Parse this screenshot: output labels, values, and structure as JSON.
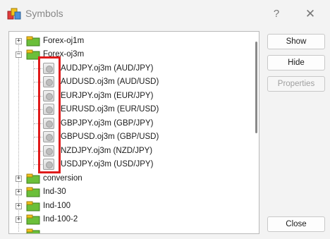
{
  "window": {
    "title": "Symbols",
    "help_glyph": "?",
    "close_glyph": "✕"
  },
  "tree": {
    "top_folders": [
      {
        "label": "Forex-oj1m",
        "expander": "+"
      },
      {
        "label": "Forex-oj3m",
        "expander": "−"
      }
    ],
    "symbols": [
      {
        "label": "AUDJPY.oj3m  (AUD/JPY)"
      },
      {
        "label": "AUDUSD.oj3m  (AUD/USD)"
      },
      {
        "label": "EURJPY.oj3m  (EUR/JPY)"
      },
      {
        "label": "EURUSD.oj3m  (EUR/USD)"
      },
      {
        "label": "GBPJPY.oj3m  (GBP/JPY)"
      },
      {
        "label": "GBPUSD.oj3m  (GBP/USD)"
      },
      {
        "label": "NZDJPY.oj3m  (NZD/JPY)"
      },
      {
        "label": "USDJPY.oj3m  (USD/JPY)"
      }
    ],
    "bottom_folders": [
      {
        "label": "conversion",
        "expander": "+"
      },
      {
        "label": "Ind-30",
        "expander": "+"
      },
      {
        "label": "Ind-100",
        "expander": "+"
      },
      {
        "label": "Ind-100-2",
        "expander": "+"
      }
    ]
  },
  "buttons": {
    "show": "Show",
    "hide": "Hide",
    "properties": "Properties",
    "close": "Close"
  },
  "colors": {
    "highlight": "#e01b1b",
    "folder_green": "#6bbf3a",
    "folder_yellow": "#f2c21b"
  }
}
